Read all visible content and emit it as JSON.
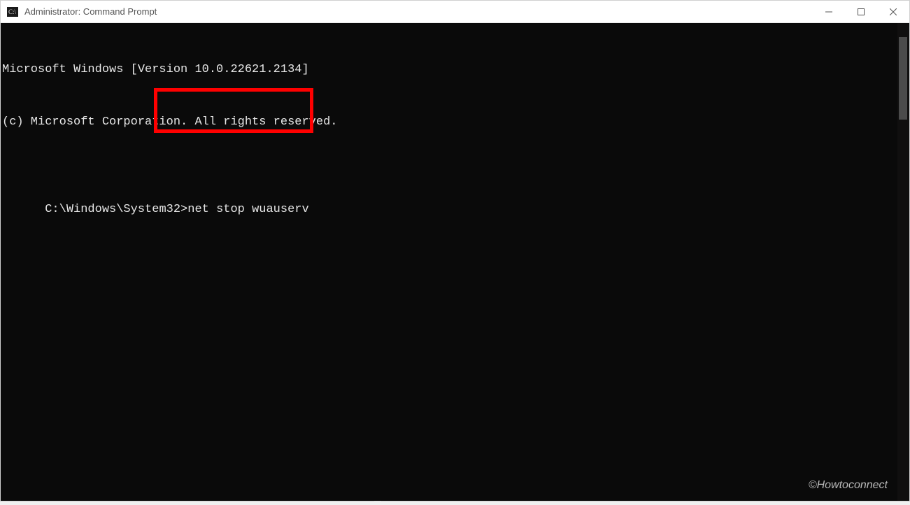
{
  "titlebar": {
    "title": "Administrator: Command Prompt"
  },
  "terminal": {
    "line1": "Microsoft Windows [Version 10.0.22621.2134]",
    "line2": "(c) Microsoft Corporation. All rights reserved.",
    "prompt": "C:\\Windows\\System32>",
    "command": "net stop wuauserv"
  },
  "watermark": "©Howtoconnect"
}
